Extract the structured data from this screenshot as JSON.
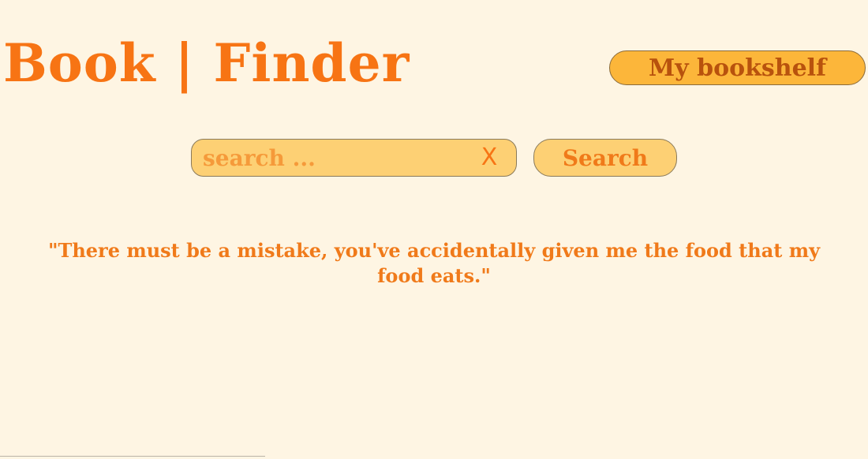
{
  "header": {
    "title": "Book | Finder",
    "bookshelf_label": "My bookshelf"
  },
  "search": {
    "placeholder": "search ...",
    "value": "",
    "clear_label": "X",
    "button_label": "Search"
  },
  "quote": {
    "text": "\"There must be a mistake, you've accidentally given me the food that my food eats.\""
  },
  "colors": {
    "background": "#fef5e3",
    "accent": "#f77414",
    "button_fill": "#fcb63a",
    "search_fill": "#fdd074"
  }
}
